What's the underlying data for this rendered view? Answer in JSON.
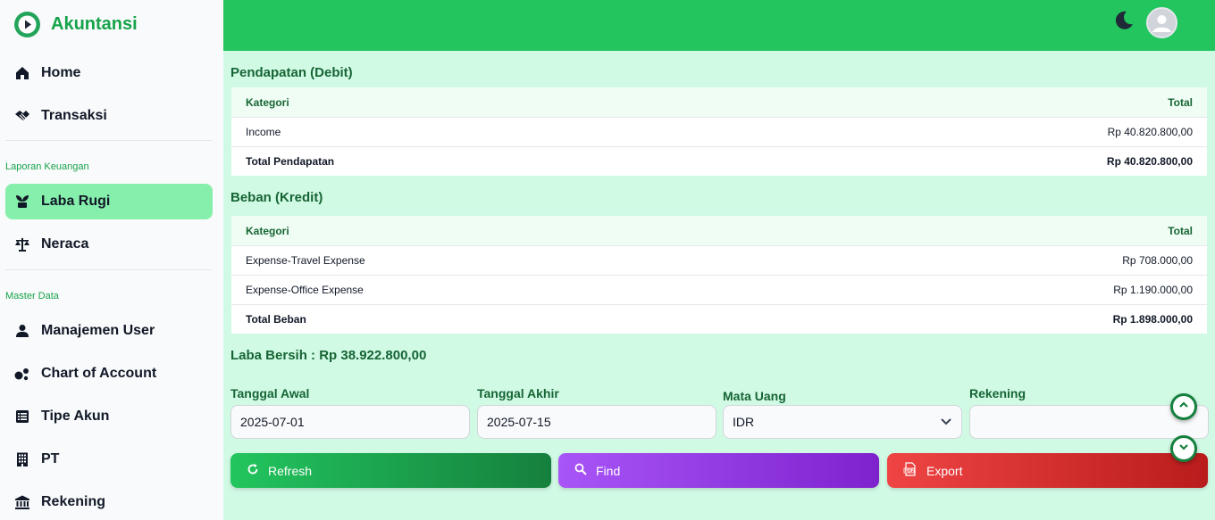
{
  "brand": {
    "name": "Akuntansi"
  },
  "nav": {
    "home": "Home",
    "transaksi": "Transaksi",
    "section_laporan": "Laporan Keuangan",
    "laba_rugi": "Laba Rugi",
    "neraca": "Neraca",
    "section_master": "Master Data",
    "manajemen_user": "Manajemen User",
    "chart_of_account": "Chart of Account",
    "tipe_akun": "Tipe Akun",
    "pt": "PT",
    "rekening": "Rekening"
  },
  "pendapatan": {
    "title": "Pendapatan (Debit)",
    "col_kategori": "Kategori",
    "col_total": "Total",
    "rows": [
      {
        "kategori": "Income",
        "total": "Rp 40.820.800,00"
      }
    ],
    "total_label": "Total Pendapatan",
    "total_value": "Rp 40.820.800,00"
  },
  "beban": {
    "title": "Beban (Kredit)",
    "col_kategori": "Kategori",
    "col_total": "Total",
    "rows": [
      {
        "kategori": "Expense-Travel Expense",
        "total": "Rp 708.000,00"
      },
      {
        "kategori": "Expense-Office Expense",
        "total": "Rp 1.190.000,00"
      }
    ],
    "total_label": "Total Beban",
    "total_value": "Rp 1.898.000,00"
  },
  "laba_bersih": "Laba Bersih : Rp 38.922.800,00",
  "filters": {
    "tanggal_awal_label": "Tanggal Awal",
    "tanggal_awal_value": "2025-07-01",
    "tanggal_akhir_label": "Tanggal Akhir",
    "tanggal_akhir_value": "2025-07-15",
    "mata_uang_label": "Mata Uang",
    "mata_uang_value": "IDR",
    "rekening_label": "Rekening",
    "rekening_value": ""
  },
  "buttons": {
    "refresh": "Refresh",
    "find": "Find",
    "export": "Export"
  },
  "colors": {
    "primary": "#22c55e",
    "background": "#d1fae5",
    "active_nav": "#86efac",
    "find": "#a855f7",
    "export": "#ef4444"
  }
}
